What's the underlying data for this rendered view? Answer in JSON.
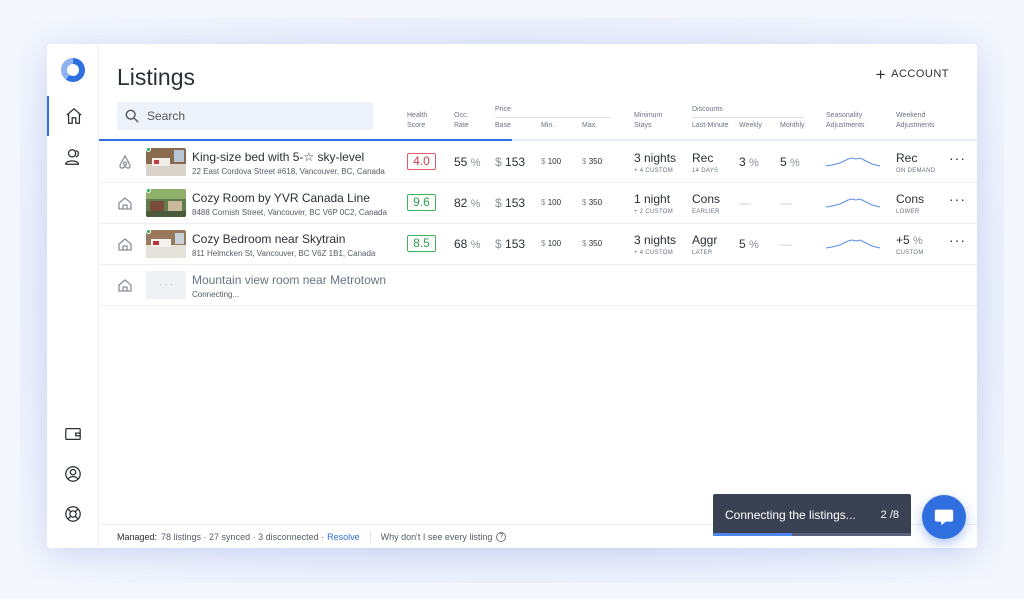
{
  "header": {
    "title": "Listings",
    "add_account": "ACCOUNT"
  },
  "search": {
    "placeholder": "Search"
  },
  "columns": {
    "health": [
      "Health",
      "Score"
    ],
    "occ": [
      "Occ.",
      "Rate"
    ],
    "price": "Price",
    "base": "Base",
    "min": "Min.",
    "max": "Max.",
    "stays": [
      "Minimum",
      "Stays"
    ],
    "discounts": "Discounts",
    "last_minute": "Last-Minute",
    "weekly": "Weekly",
    "monthly": "Monthly",
    "seasonality": [
      "Seasonality",
      "Adjustments"
    ],
    "weekend": [
      "Weekend",
      "Adjustments"
    ]
  },
  "sync_progress": 0.47,
  "listings": [
    {
      "name": "King-size bed with 5-☆ sky-level",
      "address": "22 East Cordova Street #618, Vancouver, BC, Canada",
      "platform_icon": "airbnb-icon",
      "online": true,
      "score": "4.0",
      "score_color": "#d4394d",
      "occ": "55",
      "occ_unit": "%",
      "base_unit": "$",
      "base": "153",
      "min_unit": "$",
      "min": "100",
      "max_unit": "$",
      "max": "350",
      "stay": "3 nights",
      "stay_sub": "+ 4 CUSTOM",
      "lm": "Rec",
      "lm_sub": "14 DAYS",
      "weekly": "3",
      "weekly_unit": "%",
      "monthly": "5",
      "monthly_unit": "%",
      "weekend": "Rec",
      "weekend_sub": "ON DEMAND"
    },
    {
      "name": "Cozy Room by YVR Canada Line",
      "address": "8488 Cornish Street, Vancouver, BC V6P 0C2, Canada",
      "platform_icon": "home-icon",
      "online": true,
      "score": "9.6",
      "score_color": "#2e9e4d",
      "occ": "82",
      "occ_unit": "%",
      "base_unit": "$",
      "base": "153",
      "min_unit": "$",
      "min": "100",
      "max_unit": "$",
      "max": "350",
      "stay": "1 night",
      "stay_sub": "+ 2 CUSTOM",
      "lm": "Cons",
      "lm_sub": "EARLIER",
      "weekly": "—",
      "monthly": "—",
      "weekend": "Cons",
      "weekend_sub": "LOWER"
    },
    {
      "name": "Cozy Bedroom near Skytrain",
      "address": "811 Helmcken St, Vancouver, BC V6Z 1B1, Canada",
      "platform_icon": "home-icon",
      "online": true,
      "score": "8.5",
      "score_color": "#2e9e4d",
      "occ": "68",
      "occ_unit": "%",
      "base_unit": "$",
      "base": "153",
      "min_unit": "$",
      "min": "100",
      "max_unit": "$",
      "max": "350",
      "stay": "3 nights",
      "stay_sub": "+ 4 CUSTOM",
      "lm": "Aggr",
      "lm_sub": "LATER",
      "weekly": "5",
      "weekly_unit": "%",
      "monthly": "—",
      "weekend": "+5",
      "weekend_unit": "%",
      "weekend_sub": "CUSTOM"
    }
  ],
  "pending": {
    "name": "Mountain view room near Metrotown",
    "status": "Connecting...",
    "thumb": "· · ·"
  },
  "footer": {
    "managed_label": "Managed:",
    "summary": "78 listings · 27 synced · 3 disconnected ·",
    "resolve": "Resolve",
    "why": "Why don't I see every listing",
    "q": "?"
  },
  "toast": {
    "message": "Connecting the listings...",
    "count": "2 /8",
    "progress": 0.4
  },
  "colors": {
    "accent": "#2f6fe0",
    "danger": "#d4394d",
    "success": "#2e9e4d"
  }
}
